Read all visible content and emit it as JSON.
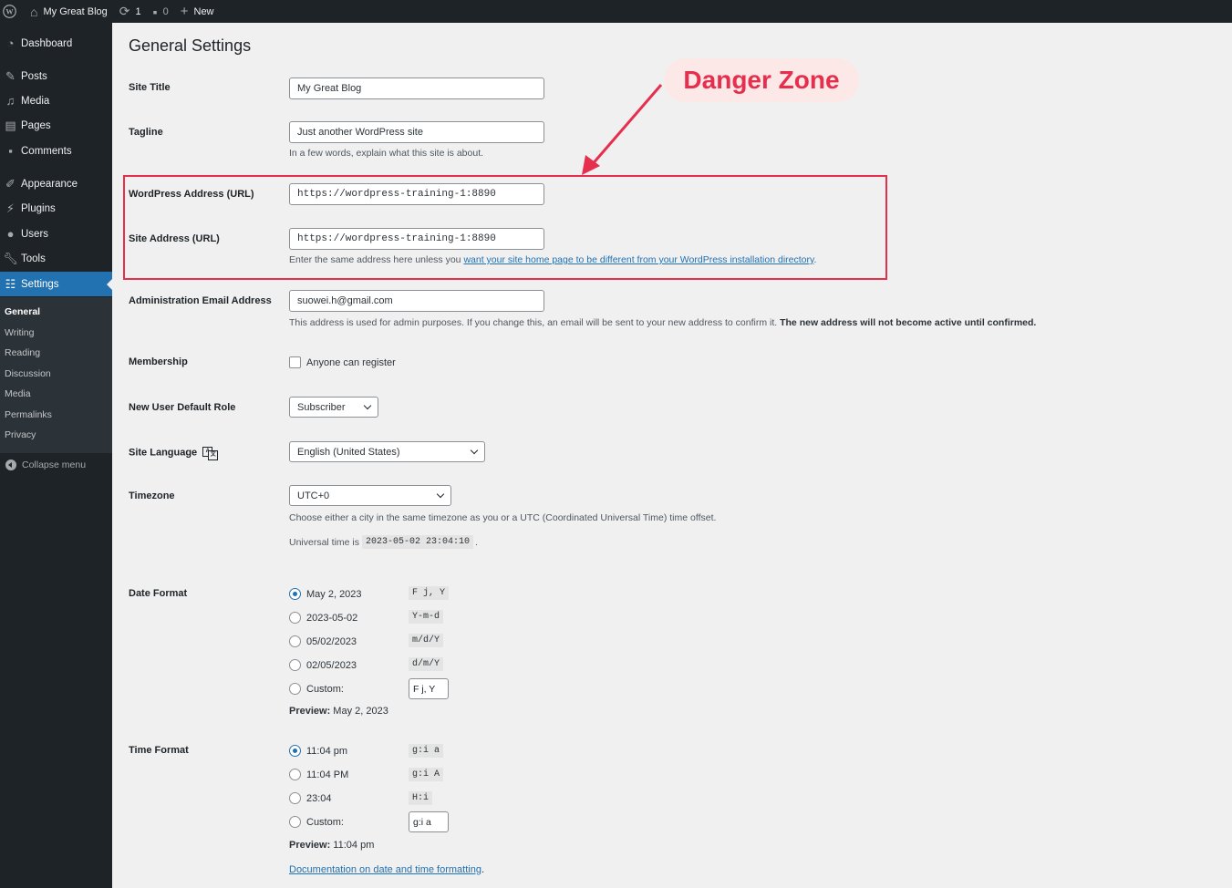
{
  "adminbar": {
    "site_name": "My Great Blog",
    "updates_count": "1",
    "comments_count": "0",
    "new_label": "New"
  },
  "sidebar": {
    "items": [
      {
        "label": "Dashboard",
        "icon": "dashboard-icon"
      },
      {
        "label": "Posts",
        "icon": "pin-icon"
      },
      {
        "label": "Media",
        "icon": "media-icon"
      },
      {
        "label": "Pages",
        "icon": "pages-icon"
      },
      {
        "label": "Comments",
        "icon": "comment-icon"
      },
      {
        "label": "Appearance",
        "icon": "brush-icon"
      },
      {
        "label": "Plugins",
        "icon": "plug-icon"
      },
      {
        "label": "Users",
        "icon": "user-icon"
      },
      {
        "label": "Tools",
        "icon": "wrench-icon"
      },
      {
        "label": "Settings",
        "icon": "settings-icon"
      }
    ],
    "submenu": [
      "General",
      "Writing",
      "Reading",
      "Discussion",
      "Media",
      "Permalinks",
      "Privacy"
    ],
    "collapse_label": "Collapse menu"
  },
  "main": {
    "title": "General Settings",
    "site_title": {
      "label": "Site Title",
      "value": "My Great Blog"
    },
    "tagline": {
      "label": "Tagline",
      "value": "Just another WordPress site",
      "desc": "In a few words, explain what this site is about."
    },
    "wp_address": {
      "label": "WordPress Address (URL)",
      "value": "https://wordpress-training-1:8890"
    },
    "site_address": {
      "label": "Site Address (URL)",
      "value": "https://wordpress-training-1:8890",
      "desc_prefix": "Enter the same address here unless you ",
      "desc_link": "want your site home page to be different from your WordPress installation directory",
      "desc_suffix": "."
    },
    "admin_email": {
      "label": "Administration Email Address",
      "value": "suowei.h@gmail.com",
      "desc": "This address is used for admin purposes. If you change this, an email will be sent to your new address to confirm it. ",
      "desc_bold": "The new address will not become active until confirmed."
    },
    "membership": {
      "label": "Membership",
      "checkbox_label": "Anyone can register",
      "checked": false
    },
    "default_role": {
      "label": "New User Default Role",
      "value": "Subscriber"
    },
    "site_language": {
      "label": "Site Language",
      "value": "English (United States)"
    },
    "timezone": {
      "label": "Timezone",
      "value": "UTC+0",
      "desc": "Choose either a city in the same timezone as you or a UTC (Coordinated Universal Time) time offset.",
      "universal_prefix": "Universal time is ",
      "universal_time": "2023-05-02 23:04:10",
      "universal_suffix": "."
    },
    "date_format": {
      "label": "Date Format",
      "options": [
        {
          "label": "May 2, 2023",
          "code": "F j, Y",
          "checked": true
        },
        {
          "label": "2023-05-02",
          "code": "Y-m-d",
          "checked": false
        },
        {
          "label": "05/02/2023",
          "code": "m/d/Y",
          "checked": false
        },
        {
          "label": "02/05/2023",
          "code": "d/m/Y",
          "checked": false
        }
      ],
      "custom_label": "Custom:",
      "custom_value": "F j, Y",
      "preview_label": "Preview:",
      "preview_value": " May 2, 2023"
    },
    "time_format": {
      "label": "Time Format",
      "options": [
        {
          "label": "11:04 pm",
          "code": "g:i a",
          "checked": true
        },
        {
          "label": "11:04 PM",
          "code": "g:i A",
          "checked": false
        },
        {
          "label": "23:04",
          "code": "H:i",
          "checked": false
        }
      ],
      "custom_label": "Custom:",
      "custom_value": "g:i a",
      "preview_label": "Preview:",
      "preview_value": " 11:04 pm"
    },
    "doc_link": "Documentation on date and time formatting",
    "doc_link_suffix": "."
  },
  "annotation": {
    "label": "Danger Zone",
    "color": "#e62e4d"
  }
}
